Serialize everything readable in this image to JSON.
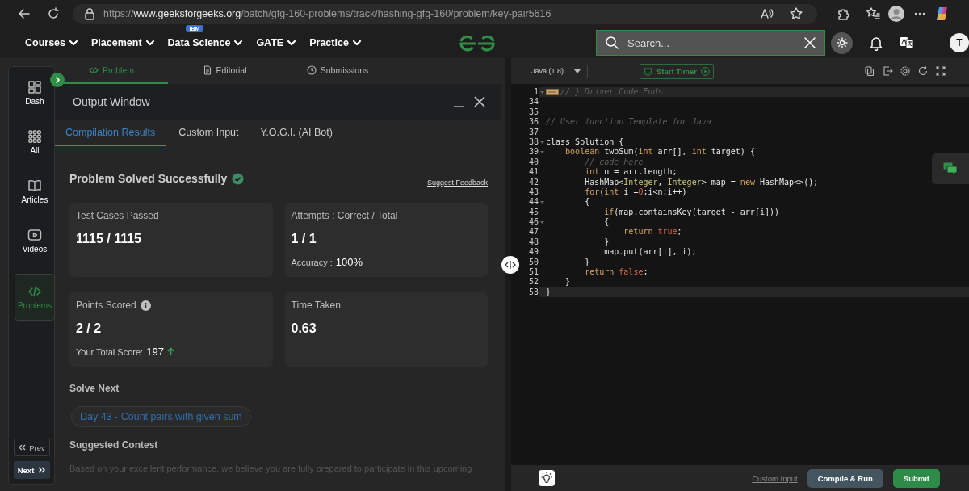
{
  "browser": {
    "url": {
      "scheme": "https://",
      "host": "www.geeksforgeeks.org",
      "path": "/batch/gfg-160-problems/track/hashing-gfg-160/problem/key-pair5616"
    }
  },
  "site_nav": {
    "items": [
      {
        "label": "Courses"
      },
      {
        "label": "Placement"
      },
      {
        "label": "Data Science",
        "badge": "IBM"
      },
      {
        "label": "GATE"
      },
      {
        "label": "Practice"
      }
    ],
    "search": {
      "placeholder": "Search..."
    },
    "avatar": "T"
  },
  "sidebar": {
    "items": [
      {
        "label": "Dash",
        "selected": false
      },
      {
        "label": "All",
        "selected": false
      },
      {
        "label": "Articles",
        "selected": false
      },
      {
        "label": "Videos",
        "selected": false
      },
      {
        "label": "Problems",
        "selected": true
      }
    ],
    "pager": [
      {
        "label": "Prev",
        "kind": "prev"
      },
      {
        "label": "Next",
        "kind": "next"
      }
    ]
  },
  "problem_tabs": [
    {
      "label": "Problem",
      "selected": true
    },
    {
      "label": "Editorial",
      "selected": false
    },
    {
      "label": "Submissions",
      "selected": false
    }
  ],
  "output_window": {
    "title": "Output Window",
    "tabs": [
      {
        "label": "Compilation Results",
        "selected": true
      },
      {
        "label": "Custom Input",
        "selected": false
      },
      {
        "label": "Y.O.G.I. (AI Bot)",
        "selected": false
      }
    ],
    "status": "Problem Solved Successfully",
    "feedback_link": "Suggest Feedback",
    "cards": [
      {
        "label": "Test Cases Passed",
        "value": "1115 / 1115"
      },
      {
        "label": "Attempts : Correct / Total",
        "value": "1 / 1",
        "sub_label": "Accuracy :",
        "sub_value": "100%"
      },
      {
        "label": "Points Scored",
        "info": true,
        "value": "2 / 2",
        "sub_label": "Your Total Score:",
        "sub_value": "197",
        "trend_up": true
      },
      {
        "label": "Time Taken",
        "value": "0.63"
      }
    ],
    "solve_next": {
      "heading": "Solve Next",
      "link": "Day 43 - Count pairs with given sum"
    },
    "contest": {
      "heading": "Suggested Contest",
      "text": "Based on your excellent performance, we believe you are fully prepared to participate in this upcoming"
    }
  },
  "editor": {
    "language": "Java (1.8)",
    "timer_button": "Start Timer",
    "lines": [
      {
        "number": "1",
        "foldable": true,
        "collapsed": true,
        "active": true,
        "tokens": [
          {
            "kind": "comment",
            "text": "// } Driver Code Ends"
          }
        ]
      },
      {
        "number": "34",
        "foldable": false,
        "collapsed": false,
        "active": false
      },
      {
        "number": "35",
        "foldable": false,
        "collapsed": false,
        "active": false
      },
      {
        "number": "36",
        "foldable": false,
        "collapsed": false,
        "active": false,
        "tokens": [
          {
            "kind": "comment",
            "text": "// User function Template for Java"
          }
        ]
      },
      {
        "number": "37",
        "foldable": false,
        "collapsed": false,
        "active": false
      },
      {
        "number": "38",
        "foldable": true,
        "collapsed": false,
        "active": false,
        "tokens": [
          {
            "kind": "plain",
            "text": "class Solution {"
          }
        ]
      },
      {
        "number": "39",
        "foldable": true,
        "collapsed": false,
        "active": false,
        "tokens": [
          {
            "kind": "keyword",
            "text": "    boolean"
          },
          {
            "kind": "plain",
            "text": " twoSum("
          },
          {
            "kind": "keyword",
            "text": "int"
          },
          {
            "kind": "plain",
            "text": " arr[], "
          },
          {
            "kind": "keyword",
            "text": "int"
          },
          {
            "kind": "plain",
            "text": " target) {"
          }
        ]
      },
      {
        "number": "40",
        "foldable": false,
        "collapsed": false,
        "active": false,
        "tokens": [
          {
            "kind": "comment",
            "text": "        // code here"
          }
        ]
      },
      {
        "number": "41",
        "foldable": false,
        "collapsed": false,
        "active": false,
        "tokens": [
          {
            "kind": "keyword",
            "text": "        int"
          },
          {
            "kind": "plain",
            "text": " n = arr.length;"
          }
        ]
      },
      {
        "number": "42",
        "foldable": false,
        "collapsed": false,
        "active": false,
        "tokens": [
          {
            "kind": "plain",
            "text": "        HashMap<"
          },
          {
            "kind": "type",
            "text": "Integer"
          },
          {
            "kind": "plain",
            "text": ", "
          },
          {
            "kind": "type",
            "text": "Integer"
          },
          {
            "kind": "plain",
            "text": "> map = "
          },
          {
            "kind": "keyword",
            "text": "new"
          },
          {
            "kind": "plain",
            "text": " HashMap<>();"
          }
        ]
      },
      {
        "number": "43",
        "foldable": false,
        "collapsed": false,
        "active": false,
        "tokens": [
          {
            "kind": "keyword",
            "text": "        for"
          },
          {
            "kind": "plain",
            "text": "("
          },
          {
            "kind": "keyword",
            "text": "int"
          },
          {
            "kind": "plain",
            "text": " i ="
          },
          {
            "kind": "literal",
            "text": "0"
          },
          {
            "kind": "plain",
            "text": ";i<n;i++)"
          }
        ]
      },
      {
        "number": "44",
        "foldable": true,
        "collapsed": false,
        "active": false,
        "tokens": [
          {
            "kind": "plain",
            "text": "        {"
          }
        ]
      },
      {
        "number": "45",
        "foldable": false,
        "collapsed": false,
        "active": false,
        "tokens": [
          {
            "kind": "keyword",
            "text": "            if"
          },
          {
            "kind": "plain",
            "text": "(map.containsKey(target - arr[i]))"
          }
        ]
      },
      {
        "number": "46",
        "foldable": true,
        "collapsed": false,
        "active": false,
        "tokens": [
          {
            "kind": "plain",
            "text": "            {"
          }
        ]
      },
      {
        "number": "47",
        "foldable": false,
        "collapsed": false,
        "active": false,
        "tokens": [
          {
            "kind": "keyword",
            "text": "                return"
          },
          {
            "kind": "literal",
            "text": " true"
          },
          {
            "kind": "plain",
            "text": ";"
          }
        ]
      },
      {
        "number": "48",
        "foldable": false,
        "collapsed": false,
        "active": false,
        "tokens": [
          {
            "kind": "plain",
            "text": "            }"
          }
        ]
      },
      {
        "number": "49",
        "foldable": false,
        "collapsed": false,
        "active": false,
        "tokens": [
          {
            "kind": "plain",
            "text": "            map.put(arr[i], i);"
          }
        ]
      },
      {
        "number": "50",
        "foldable": false,
        "collapsed": false,
        "active": false,
        "tokens": [
          {
            "kind": "plain",
            "text": "        }"
          }
        ]
      },
      {
        "number": "51",
        "foldable": false,
        "collapsed": false,
        "active": false,
        "tokens": [
          {
            "kind": "keyword",
            "text": "        return"
          },
          {
            "kind": "literal",
            "text": " false"
          },
          {
            "kind": "plain",
            "text": ";"
          }
        ]
      },
      {
        "number": "52",
        "foldable": false,
        "collapsed": false,
        "active": false,
        "tokens": [
          {
            "kind": "plain",
            "text": "    }"
          }
        ]
      },
      {
        "number": "53",
        "foldable": false,
        "collapsed": false,
        "active": true,
        "tokens": [
          {
            "kind": "plain",
            "text": "}"
          }
        ]
      }
    ],
    "footer": {
      "custom_input_link": "Custom Input",
      "compile_button": "Compile & Run",
      "submit_button": "Submit"
    }
  }
}
